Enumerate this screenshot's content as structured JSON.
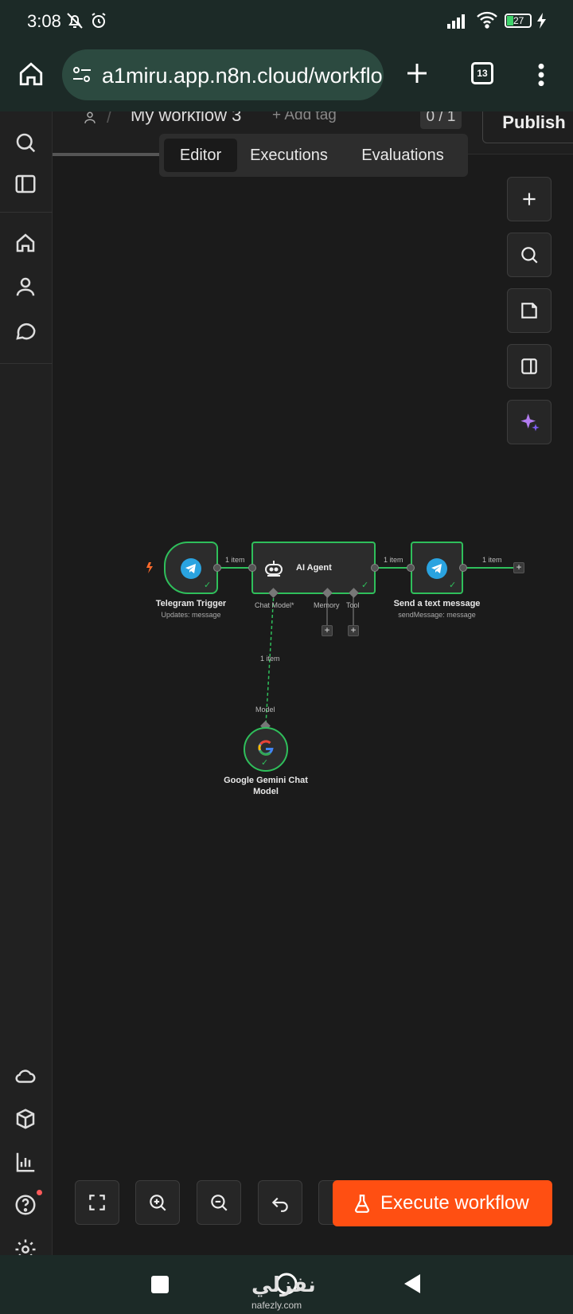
{
  "status_bar": {
    "time": "3:08",
    "battery": "27",
    "icons": [
      "bell-off-icon",
      "alarm-icon",
      "signal-icon",
      "wifi-icon",
      "battery-icon",
      "charging-icon"
    ]
  },
  "browser": {
    "url": "a1miru.app.n8n.cloud/workflo",
    "tab_count": "13",
    "icons": [
      "home-icon",
      "site-settings-icon",
      "new-tab-icon",
      "menu-dots-icon"
    ]
  },
  "header": {
    "title": "My workflow 3",
    "add_tag": "+ Add tag",
    "version": "0 / 1",
    "publish": "Publish"
  },
  "tabs": {
    "editor": "Editor",
    "executions": "Executions",
    "evaluations": "Evaluations",
    "active": "Editor"
  },
  "sidebar": {
    "top_icons": [
      "search-icon",
      "panel-toggle-icon",
      "home-icon",
      "user-icon",
      "chat-icon"
    ],
    "bottom_icons": [
      "cloud-icon",
      "templates-icon",
      "insights-icon",
      "help-icon",
      "settings-icon"
    ]
  },
  "canvas_controls": [
    "plus-icon",
    "search-icon",
    "sticky-note-icon",
    "panel-icon",
    "ai-sparkle-icon"
  ],
  "workflow": {
    "nodes": [
      {
        "id": "telegram-trigger",
        "name": "Telegram Trigger",
        "subtitle": "Updates: message"
      },
      {
        "id": "ai-agent",
        "name": "AI Agent",
        "subtitle": ""
      },
      {
        "id": "send-text",
        "name": "Send a text message",
        "subtitle": "sendMessage: message"
      },
      {
        "id": "gemini",
        "name": "Google Gemini Chat Model",
        "subtitle": ""
      }
    ],
    "connection_labels": {
      "trigger_to_agent": "1 item",
      "agent_to_send": "1 item",
      "send_out": "1 item",
      "model_link": "1 item"
    },
    "agent_ports": {
      "chat_model": "Chat Model*",
      "memory": "Memory",
      "tool": "Tool"
    },
    "model_port": "Model",
    "accent": "#2fbf5b"
  },
  "bottom_toolbar": {
    "icons": [
      "fit-view-icon",
      "zoom-in-icon",
      "zoom-out-icon",
      "undo-icon"
    ],
    "execute": "Execute workflow",
    "execute_color": "#ff4f12"
  },
  "watermark": {
    "text": "نفزلي",
    "sub": "nafezly.com"
  }
}
